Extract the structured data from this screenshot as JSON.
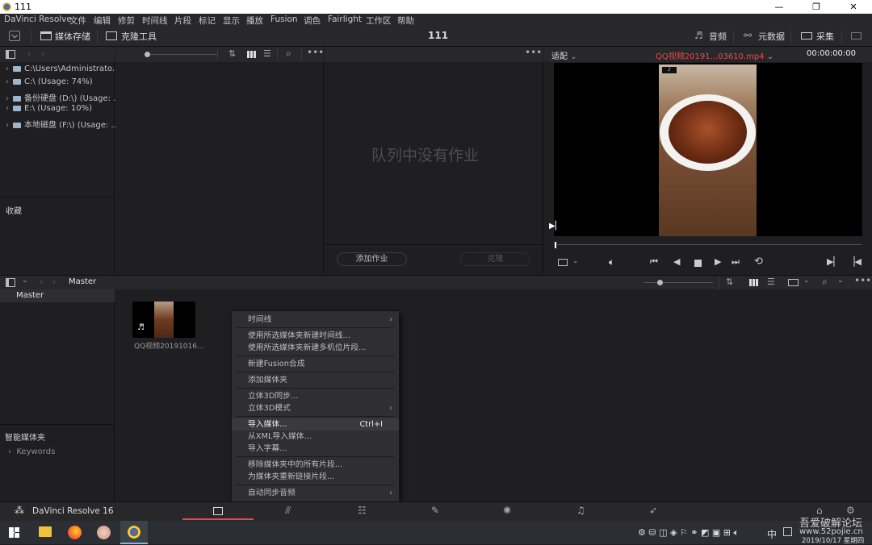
{
  "window": {
    "title": "111",
    "controls": [
      "—",
      "❐",
      "✕"
    ]
  },
  "menu": [
    "DaVinci Resolve",
    "文件",
    "编辑",
    "修剪",
    "时间线",
    "片段",
    "标记",
    "显示",
    "播放",
    "Fusion",
    "调色",
    "Fairlight",
    "工作区",
    "帮助"
  ],
  "toolbar": {
    "media_storage": "媒体存储",
    "clone_tool": "克隆工具",
    "project_name": "111",
    "audio": "音频",
    "metadata": "元数据",
    "capture": "采集"
  },
  "storage_tree": [
    "C:\\Users\\Administrato...",
    "C:\\ (Usage: 74%)",
    "备份硬盘 (D:\\) (Usage: ...",
    "E:\\ (Usage: 10%)",
    "本地磁盘 (F:\\) (Usage: ..."
  ],
  "favorites_label": "收藏",
  "clone": {
    "empty_queue": "队列中没有作业",
    "add_job": "添加作业",
    "clone_btn": "克隆"
  },
  "viewer": {
    "fit": "适配",
    "clip_name": "QQ视频20191...03610.mp4",
    "timecode": "00:00:00:00",
    "playhead_fraction": 0.0
  },
  "media_pool": {
    "breadcrumb": "Master",
    "bins": [
      "Master"
    ],
    "clip_label": "QQ视频20191016...",
    "smart_bins_label": "智能媒体夹",
    "keywords": "Keywords"
  },
  "context_menu": {
    "items": [
      {
        "label": "时间线",
        "sub": true
      },
      {
        "sep": true
      },
      {
        "label": "使用所选媒体夹新建时间线..."
      },
      {
        "label": "使用所选媒体夹新建多机位片段..."
      },
      {
        "sep": true
      },
      {
        "label": "新建Fusion合成"
      },
      {
        "sep": true
      },
      {
        "label": "添加媒体夹"
      },
      {
        "sep": true
      },
      {
        "label": "立体3D同步..."
      },
      {
        "label": "立体3D模式",
        "sub": true
      },
      {
        "sep": true
      },
      {
        "label": "导入媒体...",
        "shortcut": "Ctrl+I",
        "highlight": true
      },
      {
        "label": "从XML导入媒体..."
      },
      {
        "label": "导入字幕..."
      },
      {
        "sep": true
      },
      {
        "label": "移除媒体夹中的所有片段..."
      },
      {
        "label": "为媒体夹重新链接片段..."
      },
      {
        "sep": true
      },
      {
        "label": "自动同步音频",
        "sub": true
      }
    ]
  },
  "bottom": {
    "app_name": "DaVinci Resolve 16"
  },
  "taskbar": {
    "ime": "中",
    "watermark1": "吾爱破解论坛",
    "watermark2": "www.52pojie.cn",
    "datetime": "2019/10/17 星期四"
  },
  "colors": {
    "accent_red": "#e84a4a",
    "panel": "#1f1f22",
    "header": "#28282b"
  }
}
